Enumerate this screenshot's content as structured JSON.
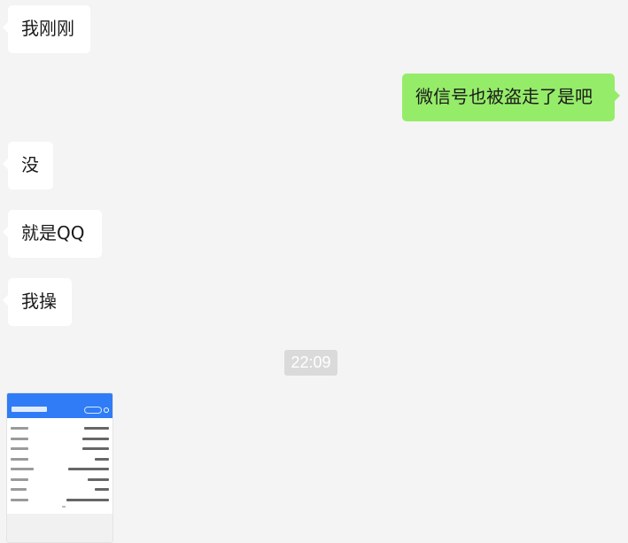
{
  "messages": [
    {
      "side": "in",
      "text": "我刚刚"
    },
    {
      "side": "out",
      "text": "微信号也被盗走了是吧"
    },
    {
      "side": "in",
      "text": "没"
    },
    {
      "side": "in",
      "text": "就是QQ"
    },
    {
      "side": "in",
      "text": "我操"
    }
  ],
  "timestamp": "22:09",
  "image_message": {
    "type": "screenshot-thumbnail"
  },
  "colors": {
    "background": "#f4f4f4",
    "incoming_bubble": "#ffffff",
    "outgoing_bubble": "#95ec69",
    "timestamp_badge": "#dadada",
    "thumbnail_header": "#2f7cf6"
  }
}
